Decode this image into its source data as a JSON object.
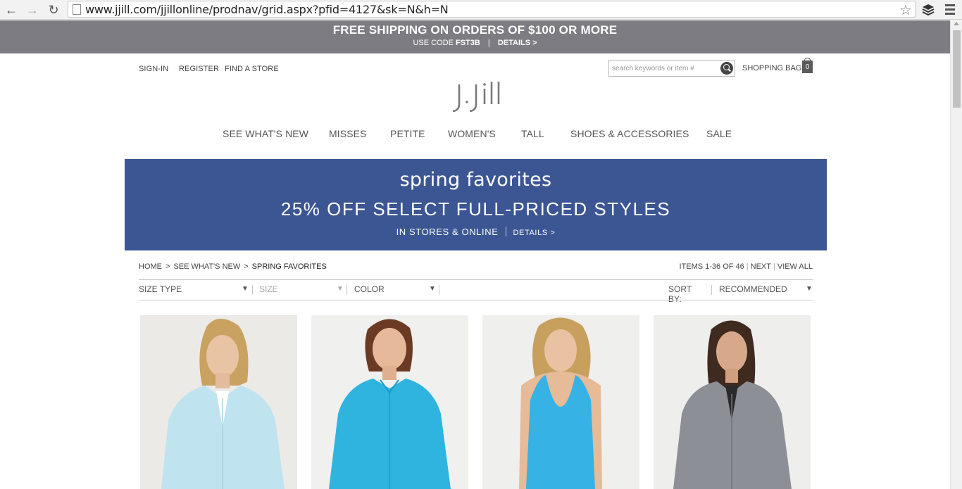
{
  "browser": {
    "url": "www.jjill.com/jjillonline/prodnav/grid.aspx?pfid=4127&sk=N&h=N",
    "icons": [
      "back-arrow-icon",
      "forward-arrow-icon",
      "reload-icon",
      "page-icon",
      "star-icon",
      "layers-icon",
      "menu-icon"
    ]
  },
  "promo": {
    "headline": "FREE SHIPPING ON ORDERS OF $100 OR MORE",
    "code_prefix": "USE CODE",
    "code": "FST3B",
    "details": "DETAILS >"
  },
  "header": {
    "sign_in": "SIGN-IN",
    "register": "REGISTER",
    "find_store": "FIND A STORE",
    "search_placeholder": "search keywords or item #",
    "bag_label": "SHOPPING BAG",
    "bag_count": "0",
    "logo": "J.Jill"
  },
  "nav": [
    "SEE WHAT'S NEW",
    "MISSES",
    "PETITE",
    "WOMEN'S",
    "TALL",
    "SHOES & ACCESSORIES",
    "SALE"
  ],
  "banner": {
    "title": "spring favorites",
    "offer": "25% OFF SELECT FULL-PRICED STYLES",
    "where": "IN STORES & ONLINE",
    "details": "DETAILS >",
    "color": "#3c5694"
  },
  "breadcrumb": {
    "home": "HOME",
    "section": "SEE WHAT'S NEW",
    "current": "SPRING FAVORITES"
  },
  "items": {
    "range": "ITEMS 1-36 OF 46",
    "next": "NEXT",
    "view_all": "VIEW ALL"
  },
  "filters": {
    "size_type": "SIZE TYPE",
    "size": "SIZE",
    "color": "COLOR",
    "sort_label": "SORT BY:",
    "sort_value": "RECOMMENDED"
  },
  "products": [
    {
      "garment": "light blue linen shirt",
      "color": "#bfe3ef"
    },
    {
      "garment": "turquoise button-front shirt",
      "color": "#2fb4e0"
    },
    {
      "garment": "turquoise tank",
      "color": "#36b2e4"
    },
    {
      "garment": "grey linen shirt",
      "color": "#8c9096"
    }
  ]
}
